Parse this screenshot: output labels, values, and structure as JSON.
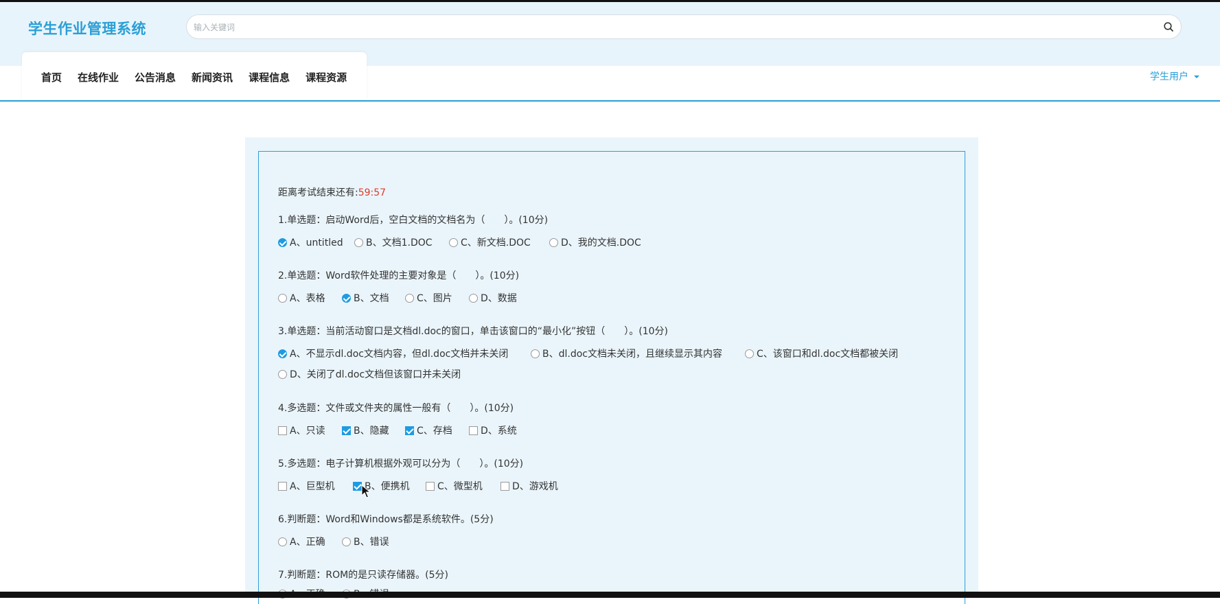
{
  "app": {
    "title": "学生作业管理系统"
  },
  "search": {
    "placeholder": "输入关键词"
  },
  "nav": {
    "items": [
      "首页",
      "在线作业",
      "公告消息",
      "新闻资讯",
      "课程信息",
      "课程资源"
    ]
  },
  "user_menu": {
    "label": "学生用户"
  },
  "exam": {
    "timer_label": "距离考试结束还有:",
    "timer_value": "59:57",
    "questions": [
      {
        "text": "1.单选题：启动Word后，空白文档的文档名为（　　）。(10分)",
        "type": "radio",
        "options": [
          {
            "label": "A、untitled",
            "checked": true
          },
          {
            "label": "B、文档1.DOC",
            "checked": false
          },
          {
            "label": "C、新文档.DOC",
            "checked": false
          },
          {
            "label": "D、我的文档.DOC",
            "checked": false
          }
        ]
      },
      {
        "text": "2.单选题：Word软件处理的主要对象是（　　）。(10分)",
        "type": "radio",
        "options": [
          {
            "label": "A、表格",
            "checked": false
          },
          {
            "label": "B、文档",
            "checked": true
          },
          {
            "label": "C、图片",
            "checked": false
          },
          {
            "label": "D、数据",
            "checked": false
          }
        ]
      },
      {
        "text": "3.单选题：当前活动窗口是文档dl.doc的窗口，单击该窗口的“最小化”按钮（　　）。(10分)",
        "type": "radio",
        "options": [
          {
            "label": "A、不显示dl.doc文档内容，但dl.doc文档并未关闭",
            "checked": true
          },
          {
            "label": "B、dl.doc文档未关闭，且继续显示其内容",
            "checked": false
          },
          {
            "label": "C、该窗口和dl.doc文档都被关闭",
            "checked": false
          },
          {
            "label": "D、关闭了dl.doc文档但该窗口并未关闭",
            "checked": false
          }
        ]
      },
      {
        "text": "4.多选题：文件或文件夹的属性一般有（　　）。(10分)",
        "type": "checkbox",
        "options": [
          {
            "label": "A、只读",
            "checked": false
          },
          {
            "label": "B、隐藏",
            "checked": true
          },
          {
            "label": "C、存档",
            "checked": true
          },
          {
            "label": "D、系统",
            "checked": false
          }
        ]
      },
      {
        "text": "5.多选题：电子计算机根据外观可以分为（　　）。(10分)",
        "type": "checkbox",
        "options": [
          {
            "label": "A、巨型机",
            "checked": false
          },
          {
            "label": "B、便携机",
            "checked": true
          },
          {
            "label": "C、微型机",
            "checked": false
          },
          {
            "label": "D、游戏机",
            "checked": false
          }
        ]
      },
      {
        "text": "6.判断题：Word和Windows都是系统软件。(5分)",
        "type": "radio",
        "options": [
          {
            "label": "A、正确",
            "checked": false
          },
          {
            "label": "B、错误",
            "checked": false
          }
        ]
      },
      {
        "text": "7.判断题：ROM的是只读存储器。(5分)",
        "type": "radio",
        "options": [
          {
            "label": "A、正确",
            "checked": false
          },
          {
            "label": "B、错误",
            "checked": false
          }
        ]
      }
    ]
  },
  "colors": {
    "accent": "#2a9fd6",
    "timer": "#e03a2c",
    "panel_bg": "#eaf5fb"
  },
  "icons": {
    "search": "search-icon",
    "caret": "caret-down-icon",
    "cursor": "mouse-pointer-icon"
  }
}
